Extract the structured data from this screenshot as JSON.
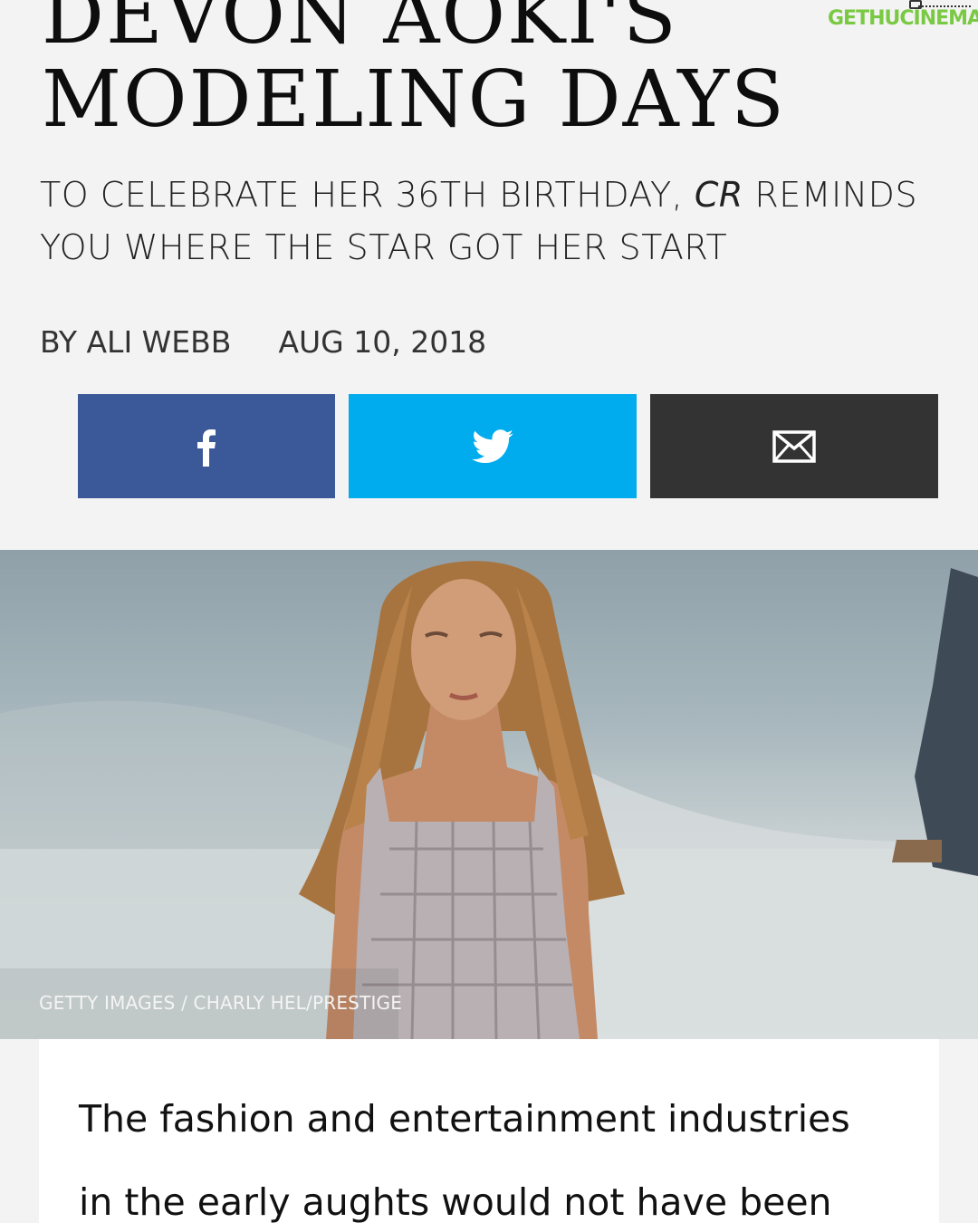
{
  "article": {
    "headline_line1": "DEVON AOKI'S",
    "headline_line2": "MODELING DAYS",
    "subtitle": {
      "part1": "TO CELEBRATE HER 36TH BIRTHDAY, ",
      "italic": "CR",
      "part2": " REMINDS",
      "line2": "YOU WHERE THE STAR GOT HER START"
    },
    "byline": "BY ALI WEBB",
    "date": "AUG 10, 2018",
    "image_caption": "GETTY IMAGES / CHARLY HEL/PRESTIGE",
    "body_line1": "The fashion and entertainment industries",
    "body_line2": "in the early aughts would not have been"
  },
  "share": {
    "facebook_icon": "facebook-icon",
    "twitter_icon": "twitter-icon",
    "email_icon": "email-icon"
  },
  "watermark": {
    "text_part1": "GETHU",
    "text_part2": "CINEMA"
  },
  "colors": {
    "background": "#f3f3f3",
    "facebook": "#3b5998",
    "twitter": "#00acee",
    "email": "#333333",
    "watermark_green": "#7ac943"
  }
}
